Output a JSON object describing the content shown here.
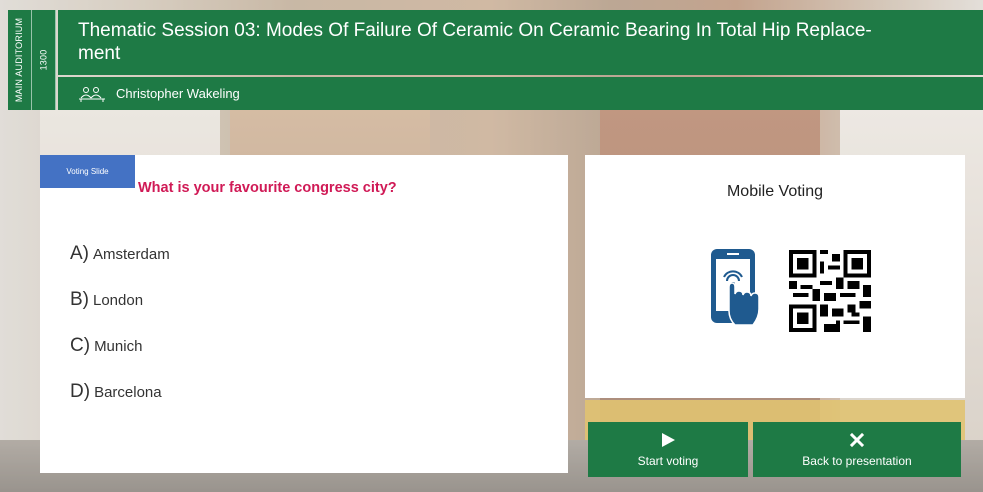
{
  "room": {
    "name": "MAIN AUDITORIUM",
    "time": "1300"
  },
  "session": {
    "title": "Thematic Session 03: Modes Of Failure Of Ceramic On Ceramic Bearing In Total Hip Replace-ment",
    "presenter": "Christopher Wakeling"
  },
  "poll": {
    "badge": "Voting Slide",
    "question": "What is your favourite congress city?",
    "answers": [
      {
        "letter": "A)",
        "text": "Amsterdam"
      },
      {
        "letter": "B)",
        "text": "London"
      },
      {
        "letter": "C)",
        "text": "Munich"
      },
      {
        "letter": "D)",
        "text": "Barcelona"
      }
    ]
  },
  "mobile": {
    "title": "Mobile Voting"
  },
  "buttons": {
    "start_label": "Start voting",
    "back_label": "Back to presentation"
  },
  "colors": {
    "brand_green": "#1e7a45",
    "question_red": "#d01a56",
    "badge_blue": "#4472c4",
    "phone_blue": "#1f5a8f"
  }
}
